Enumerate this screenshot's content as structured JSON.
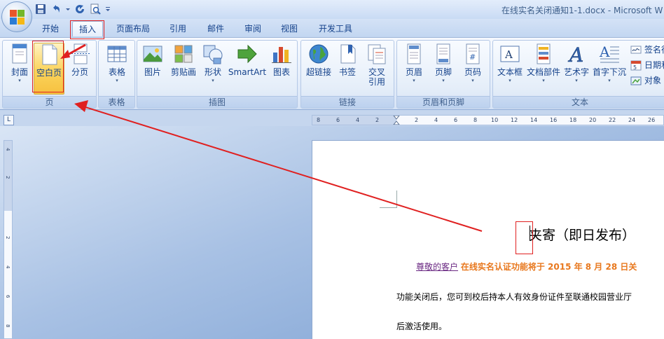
{
  "window": {
    "title": "在线实名关闭通知1-1.docx - Microsoft W"
  },
  "tabs": [
    {
      "label": "开始"
    },
    {
      "label": "插入",
      "active": true
    },
    {
      "label": "页面布局"
    },
    {
      "label": "引用"
    },
    {
      "label": "邮件"
    },
    {
      "label": "审阅"
    },
    {
      "label": "视图"
    },
    {
      "label": "开发工具"
    }
  ],
  "ribbon": {
    "groups": {
      "pages": {
        "label": "页",
        "cover": "封面",
        "blank": "空白页",
        "break": "分页"
      },
      "tables": {
        "label": "表格",
        "table": "表格"
      },
      "illustrations": {
        "label": "插图",
        "picture": "图片",
        "clipart": "剪贴画",
        "shapes": "形状",
        "smartart": "SmartArt",
        "chart": "图表"
      },
      "links": {
        "label": "链接",
        "hyperlink": "超链接",
        "bookmark": "书签",
        "crossref_line1": "交叉",
        "crossref_line2": "引用"
      },
      "header_footer": {
        "label": "页眉和页脚",
        "header": "页眉",
        "footer": "页脚",
        "page_number": "页码"
      },
      "text": {
        "label": "文本",
        "textbox": "文本框",
        "quickparts": "文档部件",
        "wordart": "艺术字",
        "dropcap": "首字下沉",
        "signature": "签名行",
        "datetime": "日期和",
        "object": "对象"
      }
    }
  },
  "ruler": {
    "corner": "L",
    "horizontal_ticks": [
      "8",
      "6",
      "4",
      "2",
      "2",
      "4",
      "6",
      "8",
      "10",
      "12",
      "14",
      "16",
      "18",
      "20",
      "22",
      "24",
      "26"
    ],
    "vertical_ticks": [
      "4",
      "2",
      "2",
      "4",
      "6",
      "8"
    ]
  },
  "document": {
    "heading": "夹寄（即日发布）",
    "greeting": "尊敬的客户",
    "notice": "在线实名认证功能将于 2015 年 8 月 28 日关",
    "line2": "功能关闭后，您可到校后持本人有效身份证件至联通校园营业厅",
    "line3": "后激活使用。"
  },
  "colors": {
    "accent": "#15428b",
    "annotation": "#e02020",
    "highlight": "#fbd35a",
    "greeting": "#6b2a83",
    "notice": "#e8781e"
  }
}
